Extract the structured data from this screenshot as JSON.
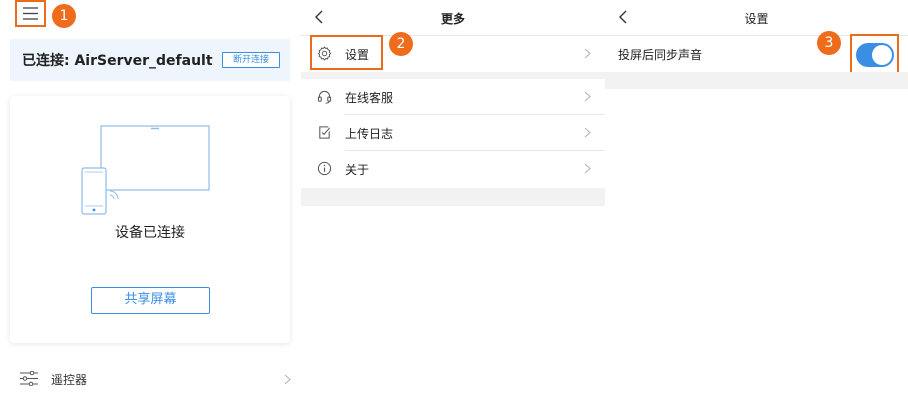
{
  "home": {
    "step_badge": "1",
    "connected_label": "已连接: AirServer_default",
    "disconnect_label": "断开连接",
    "connected_status": "设备已连接",
    "share_screen_label": "共享屏幕",
    "remote_label": "遥控器"
  },
  "more": {
    "title": "更多",
    "step_badge": "2",
    "items": [
      {
        "label": "设置",
        "icon": "gear-icon"
      },
      {
        "label": "在线客服",
        "icon": "headset-icon"
      },
      {
        "label": "上传日志",
        "icon": "log-icon"
      },
      {
        "label": "关于",
        "icon": "info-icon"
      }
    ]
  },
  "settings": {
    "title": "设置",
    "step_badge": "3",
    "sync_audio_label": "投屏后同步声音",
    "sync_audio_on": true
  },
  "colors": {
    "accent_blue": "#3a8fe3",
    "highlight_orange": "#ec6b1a",
    "connected_bg": "#eef5fc",
    "separator_grey": "#f2f2f2"
  }
}
